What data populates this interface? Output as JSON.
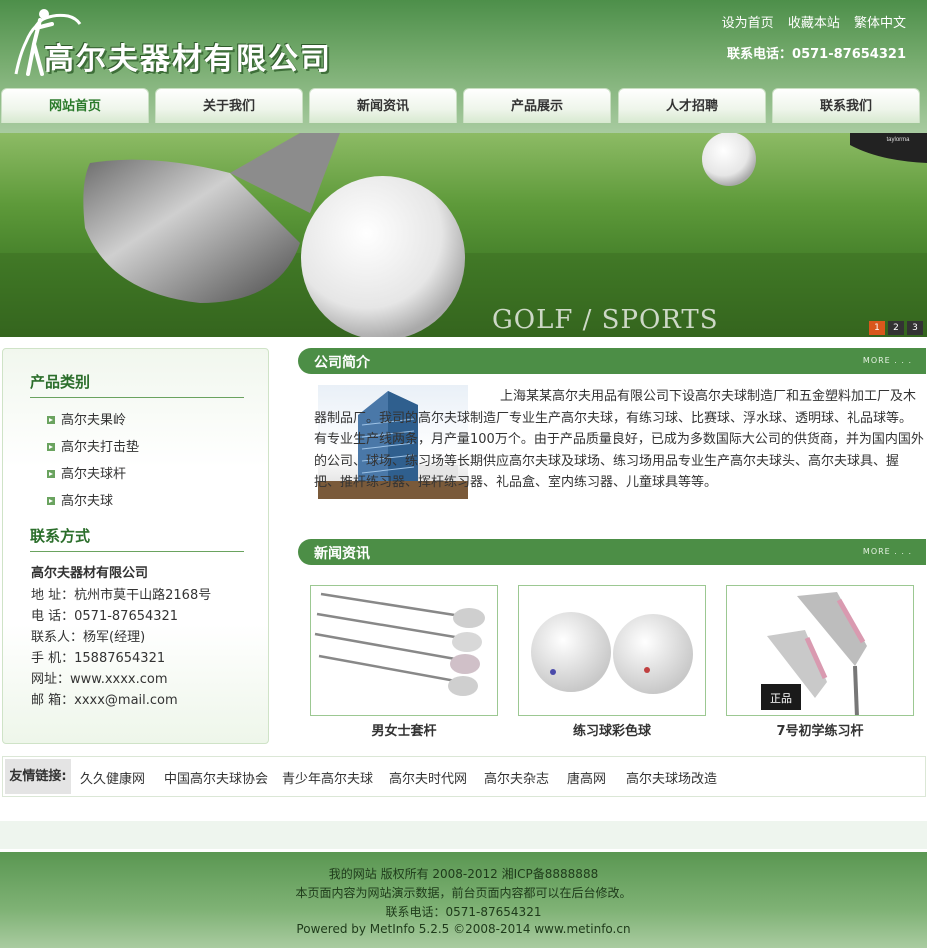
{
  "header": {
    "logo_text": "高尔夫器材有限公司",
    "top_links": [
      "设为首页",
      "收藏本站",
      "繁体中文"
    ],
    "phone": "联系电话：0571-87654321"
  },
  "nav": {
    "items": [
      "网站首页",
      "关于我们",
      "新闻资讯",
      "产品展示",
      "人才招聘",
      "联系我们"
    ],
    "active_index": 0
  },
  "banner": {
    "text": "GOLF / SPORTS",
    "brand_text": "taylorma",
    "pager": [
      "1",
      "2",
      "3"
    ],
    "active_page": "1"
  },
  "sidebar": {
    "categories_title": "产品类别",
    "categories": [
      "高尔夫果岭",
      "高尔夫打击垫",
      "高尔夫球杆",
      "高尔夫球"
    ],
    "contact_title": "联系方式",
    "company": "高尔夫器材有限公司",
    "contact_lines": [
      "地 址：杭州市莫干山路2168号",
      "电 话：0571-87654321",
      "联系人：杨军(经理)",
      "手 机：15887654321",
      "网址：www.xxxx.com",
      "邮 箱：xxxx@mail.com"
    ]
  },
  "about": {
    "title": "公司简介",
    "more": "MORE . . .",
    "text": "上海某某高尔夫用品有限公司下设高尔夫球制造厂和五金塑料加工厂及木器制品厂。我司的高尔夫球制造厂专业生产高尔夫球，有练习球、比赛球、浮水球、透明球、礼品球等。有专业生产线两条，月产量100万个。由于产品质量良好，已成为多数国际大公司的供货商，并为国内国外的公司、球场、练习场等长期供应高尔夫球及球场、练习场用品专业生产高尔夫球头、高尔夫球具、握把、推杆练习器、挥杆练习器、礼品盒、室内练习器、儿童球具等等。"
  },
  "news": {
    "title": "新闻资讯",
    "more": "MORE . . .",
    "cards": [
      "男女士套杆",
      "练习球彩色球",
      "7号初学练习杆"
    ],
    "card3_stamp": "正品"
  },
  "links": {
    "title": "友情链接:",
    "items": [
      "久久健康网",
      "中国高尔夫球协会",
      "青少年高尔夫球",
      "高尔夫时代网",
      "高尔夫杂志",
      "唐高网",
      "高尔夫球场改造"
    ]
  },
  "footer": {
    "lines": [
      "我的网站 版权所有 2008-2012 湘ICP备8888888",
      "本页面内容为网站演示数据，前台页面内容都可以在后台修改。",
      "联系电话：0571-87654321",
      "Powered by MetInfo 5.2.5 ©2008-2014 www.metinfo.cn"
    ]
  },
  "colors": {
    "brand_green": "#4c8e46",
    "pager_active": "#d9571c"
  }
}
